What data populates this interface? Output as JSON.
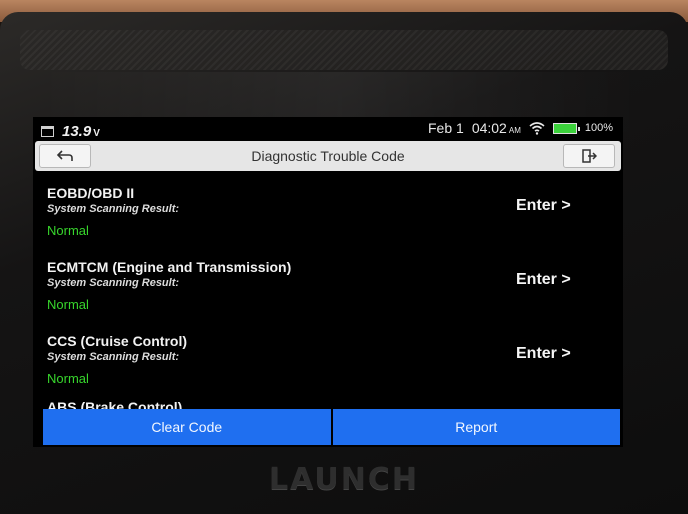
{
  "status_bar": {
    "voltage": "13.9",
    "voltage_unit": "V",
    "date": "Feb 1",
    "time": "04:02",
    "ampm": "AM",
    "battery": "100%",
    "icons": {
      "calendar": "calendar-icon",
      "wifi": "wifi-icon",
      "battery": "battery-icon"
    }
  },
  "header": {
    "title": "Diagnostic Trouble Code",
    "back_icon": "back-arrow-icon",
    "exit_icon": "exit-icon"
  },
  "systems": [
    {
      "name": "EOBD/OBD II",
      "result_label": "System Scanning Result:",
      "status": "Normal",
      "action": "Enter >"
    },
    {
      "name": "ECMTCM (Engine and Transmission)",
      "result_label": "System Scanning Result:",
      "status": "Normal",
      "action": "Enter >"
    },
    {
      "name": "CCS (Cruise Control)",
      "result_label": "System Scanning Result:",
      "status": "Normal",
      "action": "Enter >"
    },
    {
      "name": "ABS (Brake Control)"
    }
  ],
  "actions": {
    "clear_code": "Clear Code",
    "report": "Report"
  },
  "device": {
    "brand": "LAUNCH"
  },
  "colors": {
    "accent": "#1f6ff0",
    "status_normal": "#37d62c"
  }
}
